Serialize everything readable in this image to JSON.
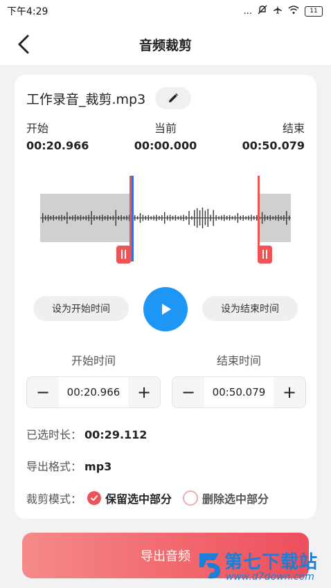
{
  "status": {
    "time": "下午4:29",
    "battery": "11",
    "more": "...",
    "icons": [
      "mute-icon",
      "airplane-icon",
      "wifi-icon",
      "battery-icon"
    ]
  },
  "header": {
    "title": "音频裁剪"
  },
  "file": {
    "name": "工作录音_裁剪.mp3"
  },
  "times": {
    "start_label": "开始",
    "start_value": "00:20.966",
    "current_label": "当前",
    "current_value": "00:00.000",
    "end_label": "结束",
    "end_value": "00:50.079"
  },
  "controls": {
    "set_start": "设为开始时间",
    "set_end": "设为结束时间"
  },
  "steppers": {
    "start_label": "开始时间",
    "start_value": "00:20.966",
    "end_label": "结束时间",
    "end_value": "00:50.079",
    "minus": "−",
    "plus": "+"
  },
  "info": {
    "duration_label": "已选时长：",
    "duration_value": "00:29.112",
    "format_label": "导出格式：",
    "format_value": "mp3"
  },
  "mode": {
    "label": "裁剪模式：",
    "keep": "保留选中部分",
    "delete": "删除选中部分",
    "selected": "keep"
  },
  "export": {
    "label": "导出音频"
  },
  "watermark": {
    "title": "第七下载站",
    "url": "www.d7down.com"
  },
  "colors": {
    "accent_blue": "#1e96f5",
    "accent_red": "#ec5455",
    "marker_blue": "#3b6fd8"
  }
}
